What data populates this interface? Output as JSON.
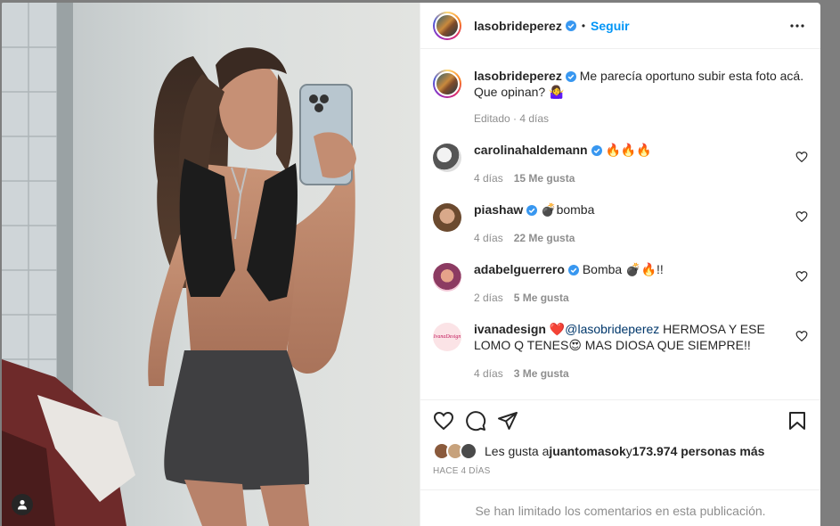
{
  "post": {
    "username": "lasobrideperez",
    "follow_label": "Seguir",
    "dot": "•",
    "caption": {
      "username": "lasobrideperez",
      "text": "Me parecía oportuno subir esta foto acá. Que opinan? 🤷‍♀️",
      "meta": "Editado · 4 días"
    }
  },
  "comments": [
    {
      "username": "carolinahaldemann",
      "verified": true,
      "text": "🔥🔥🔥",
      "time": "4 días",
      "likes": "15 Me gusta"
    },
    {
      "username": "piashaw",
      "verified": true,
      "text": "💣bomba",
      "time": "4 días",
      "likes": "22 Me gusta"
    },
    {
      "username": "adabelguerrero",
      "verified": true,
      "text": "Bomba 💣🔥!!",
      "time": "2 días",
      "likes": "5 Me gusta"
    },
    {
      "username": "ivanadesign",
      "verified": false,
      "text_pre": "❤️",
      "mention": "@lasobrideperez",
      "text_post": " HERMOSA Y ESE LOMO Q TENES😍 MAS DIOSA QUE SIEMPRE!!",
      "time": "4 días",
      "likes": "3 Me gusta",
      "avatar_label": "IvanaDesign"
    }
  ],
  "likes": {
    "prefix": "Les gusta a ",
    "user": "juantomasok",
    "middle": " y ",
    "count": "173.974 personas más"
  },
  "timestamp": "HACE 4 DÍAS",
  "limited_notice": "Se han limitado los comentarios en esta publicación.",
  "colors": {
    "accent": "#0095f6",
    "verified": "#3897f0",
    "heart": "#ed4956"
  },
  "icons": [
    "more-icon",
    "verified-icon",
    "heart-icon",
    "comment-icon",
    "share-icon",
    "save-icon",
    "user-tag-icon"
  ]
}
